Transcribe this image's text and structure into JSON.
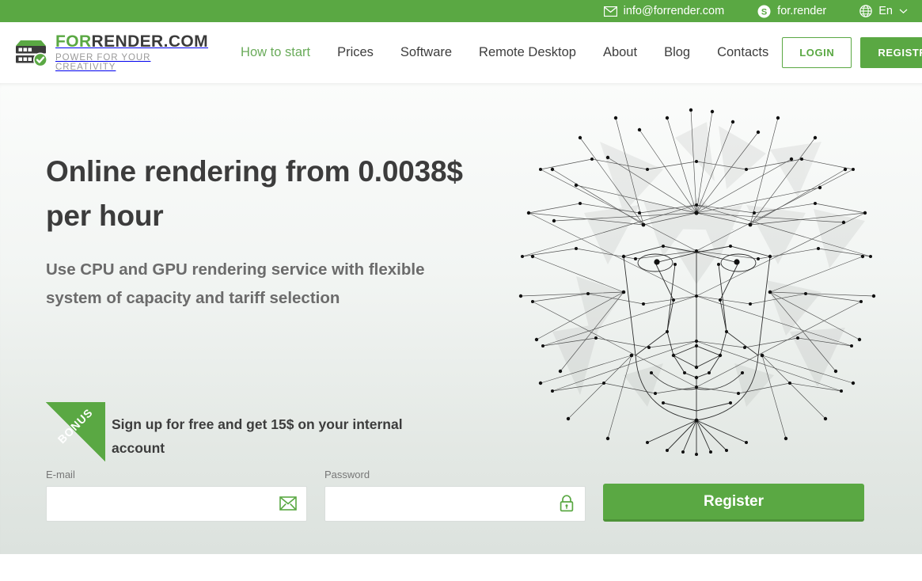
{
  "topbar": {
    "email": {
      "icon": "envelope-icon",
      "label": "info@forrender.com"
    },
    "skype": {
      "icon": "skype-icon",
      "label": "for.render"
    },
    "language": {
      "icon": "globe-icon",
      "label": "En",
      "chevron": "chevron-down-icon"
    }
  },
  "header": {
    "logo": {
      "icon": "server-check-icon",
      "title_primary": "FOR",
      "title_secondary": "RENDER.COM",
      "tagline": "POWER FOR YOUR CREATIVITY"
    },
    "nav": [
      {
        "label": "How to start",
        "active": true
      },
      {
        "label": "Prices",
        "active": false
      },
      {
        "label": "Software",
        "active": false
      },
      {
        "label": "Remote Desktop",
        "active": false
      },
      {
        "label": "About",
        "active": false
      },
      {
        "label": "Blog",
        "active": false
      },
      {
        "label": "Contacts",
        "active": false
      }
    ],
    "login_label": "LOGIN",
    "registration_label": "REGISTRATION"
  },
  "hero": {
    "title": "Online rendering from 0.0038$ per hour",
    "subtitle": "Use CPU and GPU rendering service with flexible system of capacity and tariff selection",
    "bonus": {
      "ribbon_label": "BONUS",
      "text": "Sign up for free and get 15$ on your internal account"
    },
    "form": {
      "email": {
        "label": "E-mail",
        "value": "",
        "placeholder": "",
        "icon": "envelope-icon"
      },
      "password": {
        "label": "Password",
        "value": "",
        "placeholder": "",
        "icon": "lock-icon"
      },
      "submit_label": "Register"
    },
    "illustration": "low-poly-lion-head"
  },
  "colors": {
    "brand_green": "#5aa843",
    "nav_active_green": "#6aab5a",
    "heading_dark": "#3c3c3c",
    "subtext_gray": "#6b6b6b",
    "hero_bg_top": "#fbfcfb",
    "hero_bg_bottom": "#dce2de"
  }
}
